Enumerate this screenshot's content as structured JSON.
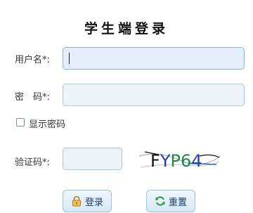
{
  "title": "学生端登录",
  "fields": {
    "username": {
      "label": "用户名*:",
      "value": ""
    },
    "password": {
      "label": "密　码*:",
      "value": ""
    },
    "captcha": {
      "label": "验证码*:",
      "value": "",
      "image_text": "FYP64"
    }
  },
  "show_password": {
    "label": "显示密码",
    "checked": false
  },
  "buttons": {
    "login": {
      "label": "登录",
      "icon": "lock-icon"
    },
    "reset": {
      "label": "重置",
      "icon": "refresh-icon"
    }
  },
  "colors": {
    "input_bg": "#edf3f9",
    "input_border": "#a9c6de",
    "button_text": "#1a3f66",
    "captcha_f": "#111111",
    "captcha_y": "#1b3fb8",
    "captcha_p": "#1d8a3e",
    "captcha_6": "#1d8a3e",
    "captcha_4": "#1b3fb8"
  }
}
